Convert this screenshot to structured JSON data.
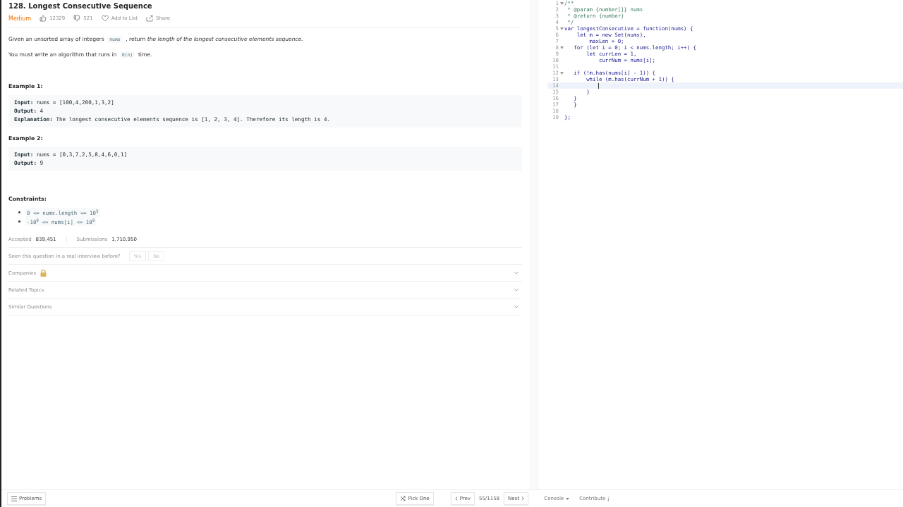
{
  "problem": {
    "title": "128. Longest Consecutive Sequence",
    "difficulty": "Medium",
    "likes": "12329",
    "dislikes": "521",
    "add_to_list": "Add to List",
    "share": "Share"
  },
  "description": [
    [
      {
        "kind": "text",
        "text": "Given an unsorted array of integers "
      },
      {
        "kind": "code",
        "text": "nums"
      },
      {
        "kind": "text",
        "text": " , return *the length of the longest consecutive elements sequence.*"
      }
    ],
    [
      {
        "kind": "text",
        "text": "You must write an algorithm that runs in "
      },
      {
        "kind": "code",
        "text": "O(n)"
      },
      {
        "kind": "text",
        "text": " time."
      }
    ]
  ],
  "examples": [
    {
      "title": "Example 1:",
      "lines": [
        "**Input:** nums = [100,4,200,1,3,2]",
        "**Output:** 4",
        "**Explanation:** The longest consecutive elements sequence is [1, 2, 3, 4]. Therefore its length is 4."
      ]
    },
    {
      "title": "Example 2:",
      "lines": [
        "**Input:** nums = [0,3,7,2,5,8,4,6,0,1]",
        "**Output:** 9"
      ]
    }
  ],
  "constraints": {
    "title": "Constraints:",
    "items": [
      "0 <= nums.length <= 10$^{5}$",
      "-10$^{9}$ <= nums[i] <= 10$^{9}$"
    ]
  },
  "stats": [
    {
      "label": "Accepted",
      "value": "839,451"
    },
    {
      "label": "Submissions",
      "value": "1,710,950"
    }
  ],
  "interview": {
    "question": "Seen this question in a real interview before?",
    "buttons": [
      "Yes",
      "No"
    ]
  },
  "sections": [
    {
      "label": "Companies",
      "locked": true
    },
    {
      "label": "Related Topics",
      "locked": false
    },
    {
      "label": "Similar Questions",
      "locked": false
    }
  ],
  "editor": {
    "lines": [
      {
        "number": "1",
        "kind": "comment",
        "text": "/**",
        "foldable": true,
        "selected": false
      },
      {
        "number": "2",
        "kind": "comment",
        "text": " * @param {number[]} nums",
        "foldable": false,
        "selected": false
      },
      {
        "number": "3",
        "kind": "comment",
        "text": " * @return {number}",
        "foldable": false,
        "selected": false
      },
      {
        "number": "4",
        "kind": "comment",
        "text": " */",
        "foldable": false,
        "selected": false
      },
      {
        "number": "5",
        "kind": "code",
        "text": "var longestConsecutive = function(nums) {",
        "foldable": true,
        "selected": false
      },
      {
        "number": "6",
        "kind": "code",
        "text": "    let m = new Set(nums),",
        "foldable": false,
        "selected": false
      },
      {
        "number": "7",
        "kind": "code",
        "text": "        maxLen = 0;",
        "foldable": false,
        "selected": false
      },
      {
        "number": "8",
        "kind": "code",
        "text": "   for (let i = 0; i < nums.length; i++) {",
        "foldable": true,
        "selected": false
      },
      {
        "number": "9",
        "kind": "code",
        "text": "       let currLen = 1,",
        "foldable": false,
        "selected": false
      },
      {
        "number": "10",
        "kind": "code",
        "text": "           currNum = nums[i];",
        "foldable": false,
        "selected": false
      },
      {
        "number": "11",
        "kind": "code",
        "foldable": false,
        "selected": false
      },
      {
        "number": "12",
        "kind": "code",
        "text": "   if (!m.has(nums[i] - 1)) {",
        "foldable": true,
        "selected": false
      },
      {
        "number": "13",
        "kind": "code",
        "text": "       while (m.has(currNum + 1)) {",
        "foldable": false,
        "selected": false
      },
      {
        "number": "14",
        "kind": "code",
        "foldable": false,
        "selected": true
      },
      {
        "number": "15",
        "kind": "code",
        "text": "       }",
        "foldable": false,
        "selected": false
      },
      {
        "number": "16",
        "kind": "code",
        "text": "   }",
        "foldable": false,
        "selected": false
      },
      {
        "number": "17",
        "kind": "code",
        "text": "   }",
        "foldable": false,
        "selected": false
      },
      {
        "number": "18",
        "kind": "code",
        "foldable": false,
        "selected": false
      },
      {
        "number": "19",
        "kind": "code",
        "text": "};",
        "foldable": false,
        "selected": false
      }
    ]
  },
  "bottom_bar": {
    "problems": "Problems",
    "pick_one": "Pick One",
    "prev": "Prev",
    "position": "55/1158",
    "next": "Next",
    "console": "Console",
    "contribute": "Contribute"
  }
}
